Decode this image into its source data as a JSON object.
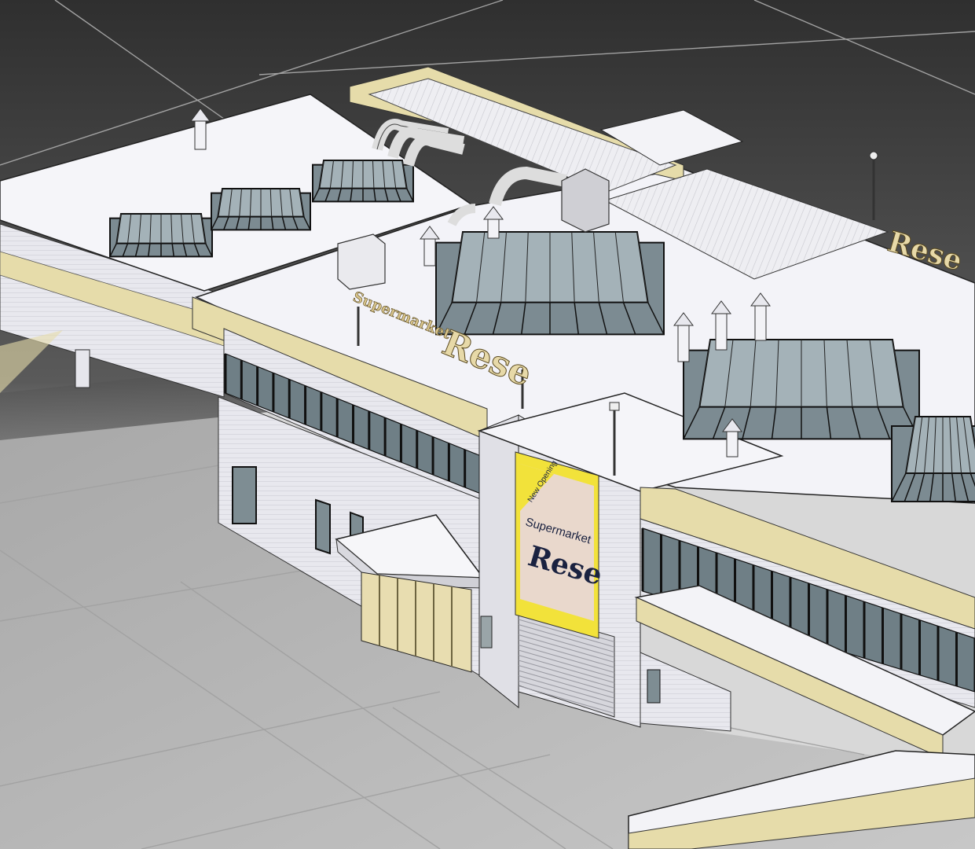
{
  "scene": {
    "kind": "3d-wireframe-render",
    "subject": "supermarket-building",
    "colors": {
      "background_top": "#3c3c3c",
      "floor": "#dcdcdc",
      "grid_line": "#9a9a9a",
      "roof": "#f4f4f8",
      "wall": "#e9e9ee",
      "trim_yellow": "#e6dcaa",
      "glass": "#7c8b92",
      "outline": "#202020",
      "banner_yellow": "#f2e23a",
      "banner_bg": "#e9d8cc",
      "banner_text": "#1a2240",
      "sign_gold": "#d8c48a"
    }
  },
  "roof_sign": {
    "small_text": "Supermarket",
    "big_text": "Rese"
  },
  "banner": {
    "corner_text": "New Opening",
    "title": "Supermarket",
    "name": "Rese"
  },
  "far_sign": {
    "text": "Rese"
  }
}
